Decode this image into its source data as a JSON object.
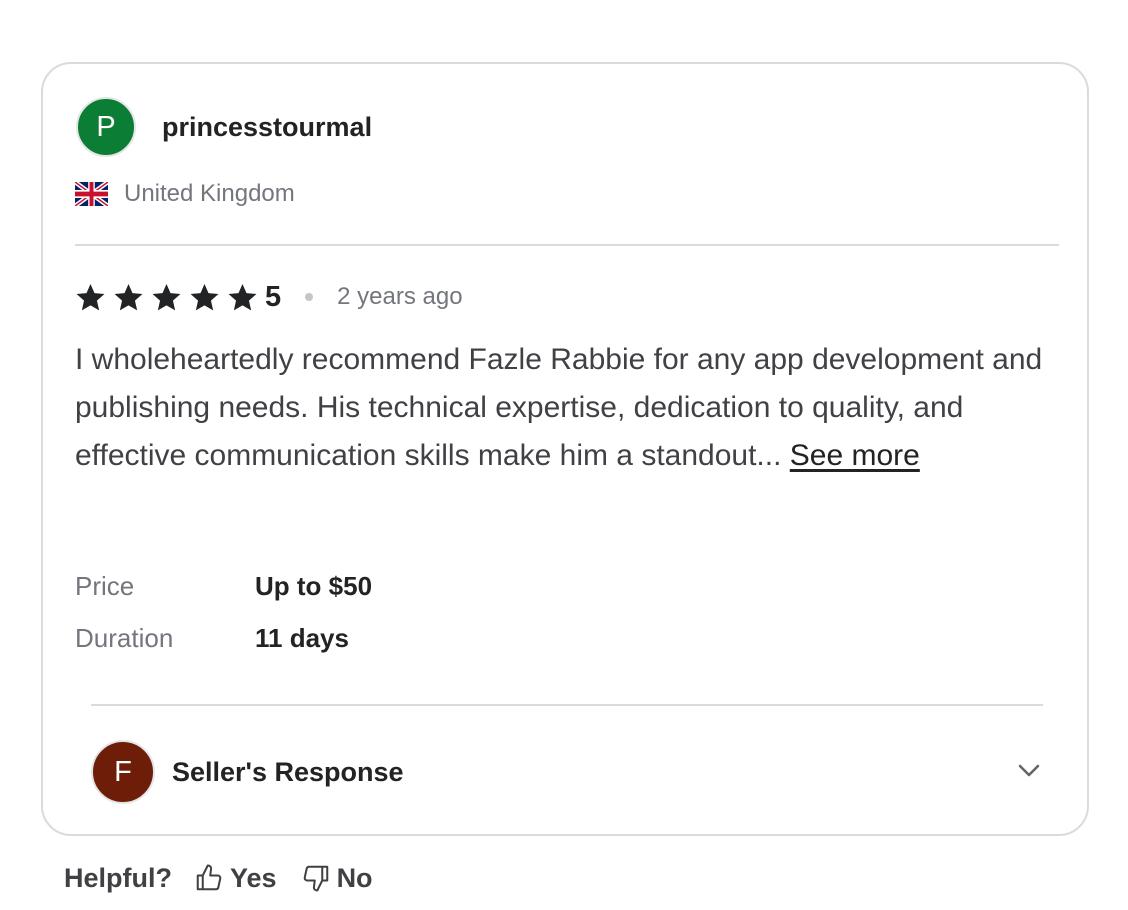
{
  "review": {
    "user": {
      "initial": "P",
      "username": "princesstourmal",
      "avatar_color": "#0b7d35"
    },
    "country": {
      "flag_icon": "uk-flag-icon",
      "name": "United Kingdom"
    },
    "rating": {
      "stars": 5,
      "value": "5"
    },
    "time_ago": "2 years ago",
    "text": "I wholeheartedly recommend Fazle Rabbie for any app development and publishing needs. His technical expertise, dedication to quality, and effective communication skills make him a standout...",
    "see_more": "See more",
    "details": [
      {
        "label": "Price",
        "value": "Up to $50"
      },
      {
        "label": "Duration",
        "value": "11 days"
      }
    ],
    "seller_response": {
      "initial": "F",
      "label": "Seller's Response",
      "avatar_color": "#6e1e08"
    }
  },
  "helpful": {
    "label": "Helpful?",
    "yes": "Yes",
    "no": "No"
  },
  "colors": {
    "star": "#222325",
    "border": "#dadbdd",
    "muted_text": "#74767e"
  }
}
